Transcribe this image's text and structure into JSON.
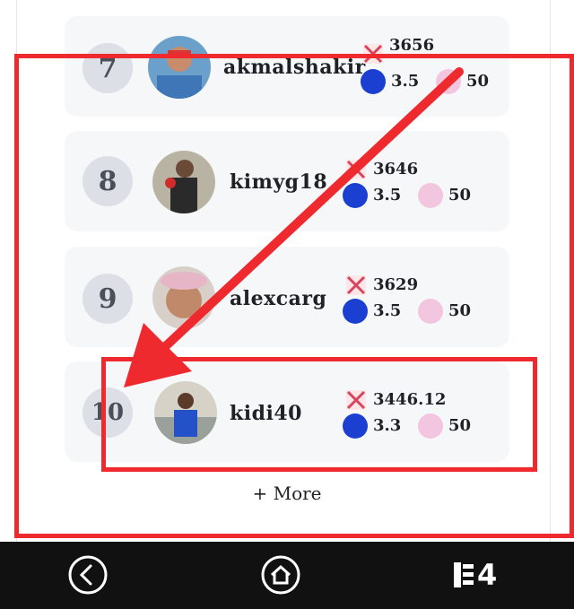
{
  "leaderboard": {
    "rows": [
      {
        "rank": "7",
        "username": "akmalshakir",
        "power": "3656",
        "steem": "3.5",
        "cards": "50"
      },
      {
        "rank": "8",
        "username": "kimyg18",
        "power": "3646",
        "steem": "3.5",
        "cards": "50"
      },
      {
        "rank": "9",
        "username": "alexcarg",
        "power": "3629",
        "steem": "3.5",
        "cards": "50"
      },
      {
        "rank": "10",
        "username": "kidi40",
        "power": "3446.12",
        "steem": "3.3",
        "cards": "50"
      }
    ],
    "more_label": "+ More"
  },
  "colors": {
    "annotation": "#ee2a2f",
    "steem": "#1a3fd1",
    "rank_bg": "#dcdfe6",
    "row_bg": "#f6f7f9"
  },
  "navbar": {
    "back_icon": "chevron-left-icon",
    "home_icon": "home-icon",
    "apps_label": "4"
  }
}
